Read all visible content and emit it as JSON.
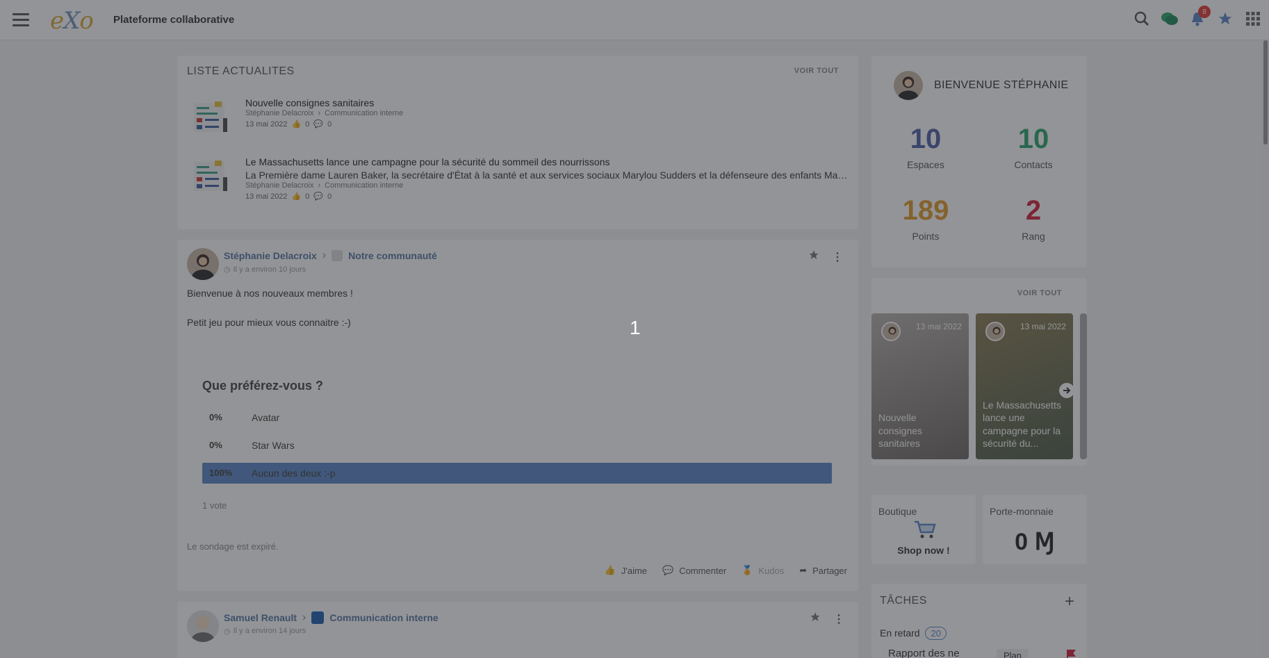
{
  "header": {
    "app_title": "Plateforme collaborative",
    "notification_count": "8"
  },
  "news": {
    "title": "LISTE ACTUALITES",
    "voir_tout": "VOIR TOUT",
    "items": [
      {
        "title": "Nouvelle consignes sanitaires",
        "excerpt": "",
        "author": "Stéphanie Delacroix",
        "space": "Communication interne",
        "date": "13 mai 2022",
        "likes": "0",
        "comments": "0"
      },
      {
        "title": "Le Massachusetts lance une campagne pour la sécurité du sommeil des nourrissons",
        "excerpt": "La Première dame Lauren Baker, la secrétaire d'État à la santé et aux services sociaux Marylou Sudders et la défenseure des enfants Maria Mossaides ont lancé une campagne",
        "author": "Stéphanie Delacroix",
        "space": "Communication interne",
        "date": "13 mai 2022",
        "likes": "0",
        "comments": "0"
      }
    ]
  },
  "activity": {
    "author": "Stéphanie Delacroix",
    "space": "Notre communauté",
    "time": "Il y a environ 10 jours",
    "line1": "Bienvenue à nos nouveaux membres !",
    "line2": "Petit jeu pour mieux vous connaitre :-)",
    "poll": {
      "question": "Que préférez-vous ?",
      "options": [
        {
          "pct_label": "0%",
          "label": "Avatar",
          "value": 0
        },
        {
          "pct_label": "0%",
          "label": "Star Wars",
          "value": 0
        },
        {
          "pct_label": "100%",
          "label": "Aucun des deux :-p",
          "value": 1
        }
      ],
      "votes": "1 vote",
      "expired": "Le sondage est expiré."
    },
    "actions": {
      "like": "J'aime",
      "comment": "Commenter",
      "kudos": "Kudos",
      "share": "Partager"
    }
  },
  "activity2": {
    "author": "Samuel Renault",
    "space": "Communication interne",
    "time": "Il y a environ 14 jours"
  },
  "profile": {
    "welcome": "BIENVENUE STÉPHANIE",
    "stats": [
      {
        "value": "10",
        "label": "Espaces",
        "color": "#4f5ea6"
      },
      {
        "value": "10",
        "label": "Contacts",
        "color": "#2aa46d"
      },
      {
        "value": "189",
        "label": "Points",
        "color": "#e09a2b"
      },
      {
        "value": "2",
        "label": "Rang",
        "color": "#d0213d"
      }
    ]
  },
  "slider": {
    "voir_tout": "VOIR TOUT",
    "slides": [
      {
        "date": "13 mai 2022",
        "title": "Nouvelle consignes sanitaires"
      },
      {
        "date": "13 mai 2022",
        "title": "Le Massachusetts lance une campagne pour la sécurité du..."
      }
    ]
  },
  "shop": {
    "title": "Boutique",
    "cta": "Shop now !"
  },
  "wallet": {
    "title": "Porte-monnaie",
    "amount": "0"
  },
  "tasks": {
    "title": "TÂCHES",
    "overdue_label": "En retard",
    "overdue_count": "20",
    "first_task": "Rapport des ne",
    "first_tag": "Plan"
  },
  "overlay": {
    "number": "1",
    "color": "#282a30"
  }
}
